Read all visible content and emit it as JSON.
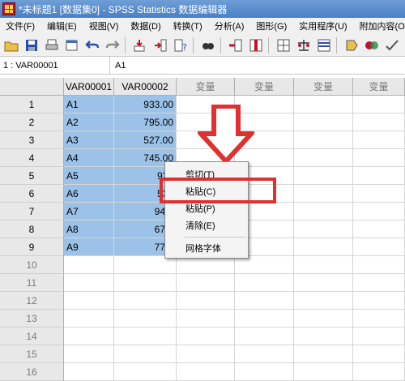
{
  "window": {
    "title": "*未标题1 [数据集0] - SPSS Statistics 数据编辑器"
  },
  "menu": [
    "文件(F)",
    "编辑(E)",
    "视图(V)",
    "数据(D)",
    "转换(T)",
    "分析(A)",
    "图形(G)",
    "实用程序(U)",
    "附加内容(O)"
  ],
  "toolbar": [
    "open-icon",
    "save-icon",
    "print-icon",
    "recall-dialog-icon",
    "undo-icon",
    "redo-icon",
    "goto-case-icon",
    "goto-variable-icon",
    "variables-icon",
    "find-icon",
    "insert-cases-icon",
    "insert-variable-icon",
    "split-file-icon",
    "weight-cases-icon",
    "select-cases-icon",
    "value-labels-icon",
    "use-sets-icon",
    "spelling-icon"
  ],
  "cellbar": {
    "ref": "1 : VAR00001",
    "value": "A1"
  },
  "columns": [
    "VAR00001",
    "VAR00002",
    "变量",
    "变量",
    "变量",
    "变量"
  ],
  "rows": [
    {
      "num": "1",
      "var1": "A1",
      "var2": "933.00"
    },
    {
      "num": "2",
      "var1": "A2",
      "var2": "795.00"
    },
    {
      "num": "3",
      "var1": "A3",
      "var2": "527.00"
    },
    {
      "num": "4",
      "var1": "A4",
      "var2": "745.00"
    },
    {
      "num": "5",
      "var1": "A5",
      "var2": "921"
    },
    {
      "num": "6",
      "var1": "A6",
      "var2": "535"
    },
    {
      "num": "7",
      "var1": "A7",
      "var2": "943."
    },
    {
      "num": "8",
      "var1": "A8",
      "var2": "676."
    },
    {
      "num": "9",
      "var1": "A9",
      "var2": "774."
    }
  ],
  "empty_rows": [
    "10",
    "11",
    "12",
    "13",
    "14",
    "15",
    "16"
  ],
  "context_menu": {
    "items": [
      "剪切(T)",
      "粘贴(C)",
      "粘贴(P)",
      "清除(E)",
      "网格字体"
    ]
  },
  "colors": {
    "selection": "#9cc2e8",
    "highlight": "#e03131"
  }
}
